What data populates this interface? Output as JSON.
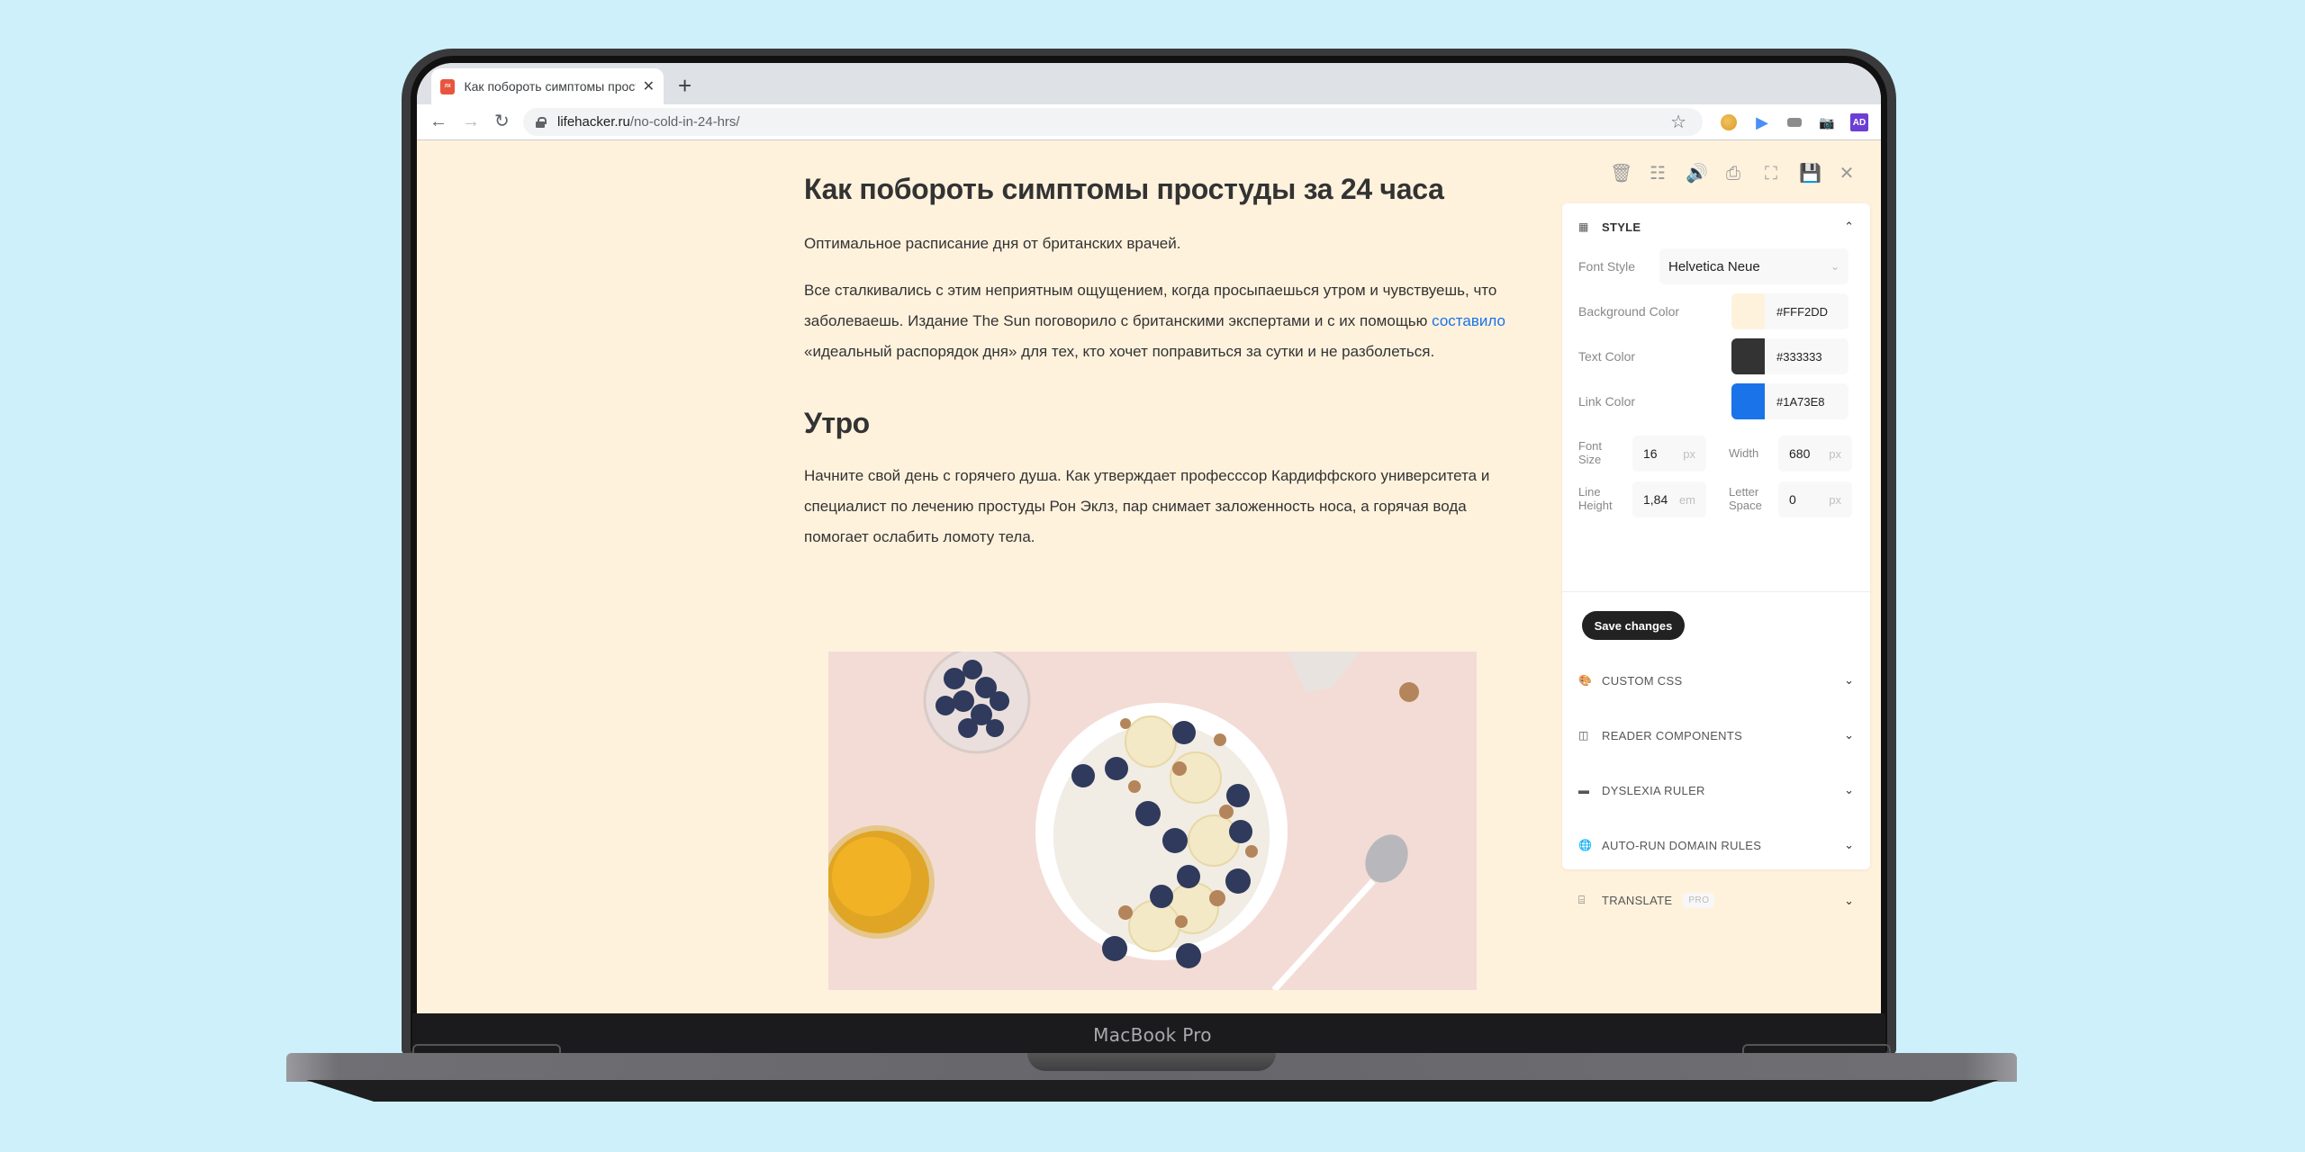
{
  "browser": {
    "tab_title": "Как побороть симптомы прост",
    "tab_favicon_text": "ЛАЙФ ХАКЕР",
    "new_tab_label": "+",
    "url_host": "lifehacker.ru",
    "url_path": "/no-cold-in-24-hrs/",
    "extensions": [
      "cookie-extension",
      "play-extension",
      "storage-extension",
      "camera-extension",
      "ad-extension",
      "reader-extension"
    ]
  },
  "article": {
    "title": "Как побороть симптомы простуды за 24 часа",
    "subtitle": "Оптимальное расписание дня от британских врачей.",
    "intro_before_link": "Все сталкивались с этим неприятным ощущением, когда просыпаешься утром и чувствуешь, что заболеваешь. Издание The Sun поговорило с британскими экспертами и с их помощью ",
    "intro_link": "составило",
    "intro_after_link": " «идеальный распорядок дня» для тех, кто хочет поправиться за сутки и не разболеться.",
    "section_heading": "Утро",
    "section_text": "Начните свой день с горячего душа. Как утверждает професссор Кардиффского университета и специалист по лечению простуды Рон Эклз, пар снимает заложенность носа, а горячая вода помогает ослабить ломоту тела.",
    "image_alt": "Овсяная каша с бананом, черникой и грецкими орехами"
  },
  "reader_toolbar": [
    "delete",
    "adjust",
    "speak",
    "print",
    "fullscreen",
    "save",
    "close"
  ],
  "panel": {
    "style": {
      "title": "STYLE",
      "font_style_label": "Font Style",
      "font_style_value": "Helvetica Neue",
      "background_color_label": "Background Color",
      "background_color_value": "#FFF2DD",
      "text_color_label": "Text Color",
      "text_color_value": "#333333",
      "link_color_label": "Link Color",
      "link_color_value": "#1A73E8",
      "font_size_label_1": "Font",
      "font_size_label_2": "Size",
      "font_size_value": "16",
      "font_size_unit": "px",
      "width_label": "Width",
      "width_value": "680",
      "width_unit": "px",
      "line_height_label_1": "Line",
      "line_height_label_2": "Height",
      "line_height_value": "1,84",
      "line_height_unit": "em",
      "letter_space_label_1": "Letter",
      "letter_space_label_2": "Space",
      "letter_space_value": "0",
      "letter_space_unit": "px",
      "save_label": "Save changes"
    },
    "sections": [
      {
        "title": "CUSTOM CSS"
      },
      {
        "title": "READER COMPONENTS"
      },
      {
        "title": "DYSLEXIA RULER"
      },
      {
        "title": "AUTO-RUN DOMAIN RULES"
      },
      {
        "title": "TRANSLATE",
        "badge": "PRO"
      }
    ]
  },
  "device": {
    "label": "MacBook Pro"
  },
  "colors": {
    "page_background": "#FFF2DD",
    "text": "#333333",
    "link": "#1A73E8",
    "desktop": "#CDF0FA"
  }
}
